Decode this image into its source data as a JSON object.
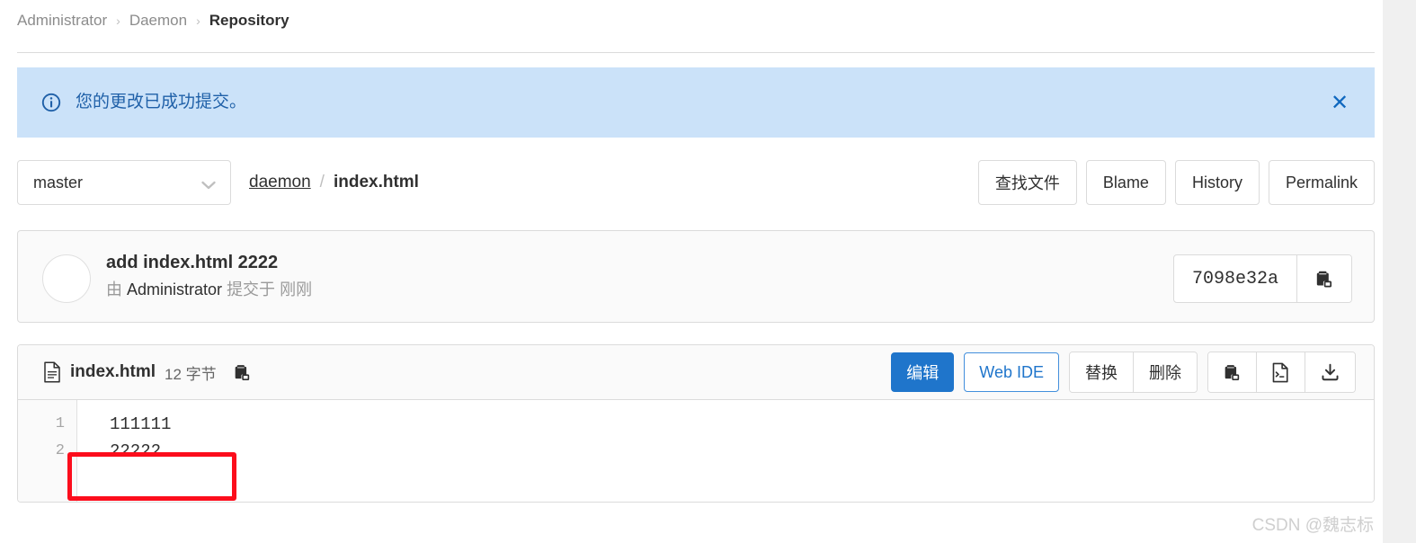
{
  "breadcrumb": {
    "items": [
      {
        "label": "Administrator",
        "current": false
      },
      {
        "label": "Daemon",
        "current": false
      },
      {
        "label": "Repository",
        "current": true
      }
    ],
    "separator": "›"
  },
  "alert": {
    "icon": "info-circle-icon",
    "message": "您的更改已成功提交。",
    "close_label": "✕",
    "background": "#cbe2f9",
    "text_color": "#1f60a8"
  },
  "toolbar": {
    "branch": {
      "value": "master",
      "icon": "chevron-down-icon"
    },
    "path": {
      "dir": "daemon",
      "separator": "/",
      "file": "index.html"
    },
    "actions": [
      {
        "label": "查找文件",
        "name": "find-file-button"
      },
      {
        "label": "Blame",
        "name": "blame-button"
      },
      {
        "label": "History",
        "name": "history-button"
      },
      {
        "label": "Permalink",
        "name": "permalink-button"
      }
    ]
  },
  "commit": {
    "title": "add index.html 2222",
    "by_prefix": "由",
    "author": "Administrator",
    "action": "提交于",
    "time": "刚刚",
    "hash": "7098e32a",
    "copy_icon": "clipboard-icon"
  },
  "file": {
    "icon": "document-icon",
    "name": "index.html",
    "size": "12 字节",
    "copy_icon": "clipboard-icon",
    "actions": {
      "edit": "编辑",
      "web_ide": "Web IDE",
      "replace": "替换",
      "delete": "删除",
      "copy_icon": "clipboard-icon",
      "raw_icon": "file-code-icon",
      "download_icon": "download-icon"
    },
    "lines": [
      {
        "number": "1",
        "text": "111111"
      },
      {
        "number": "2",
        "text": "22222"
      }
    ]
  },
  "annotation": {
    "color": "#fc0d1c",
    "target_line": "2"
  },
  "watermark": {
    "text": "CSDN @魏志标"
  },
  "colors": {
    "primary": "#1f75cb",
    "link": "#1068bf",
    "border": "#dbdbdb",
    "muted": "#666666"
  }
}
